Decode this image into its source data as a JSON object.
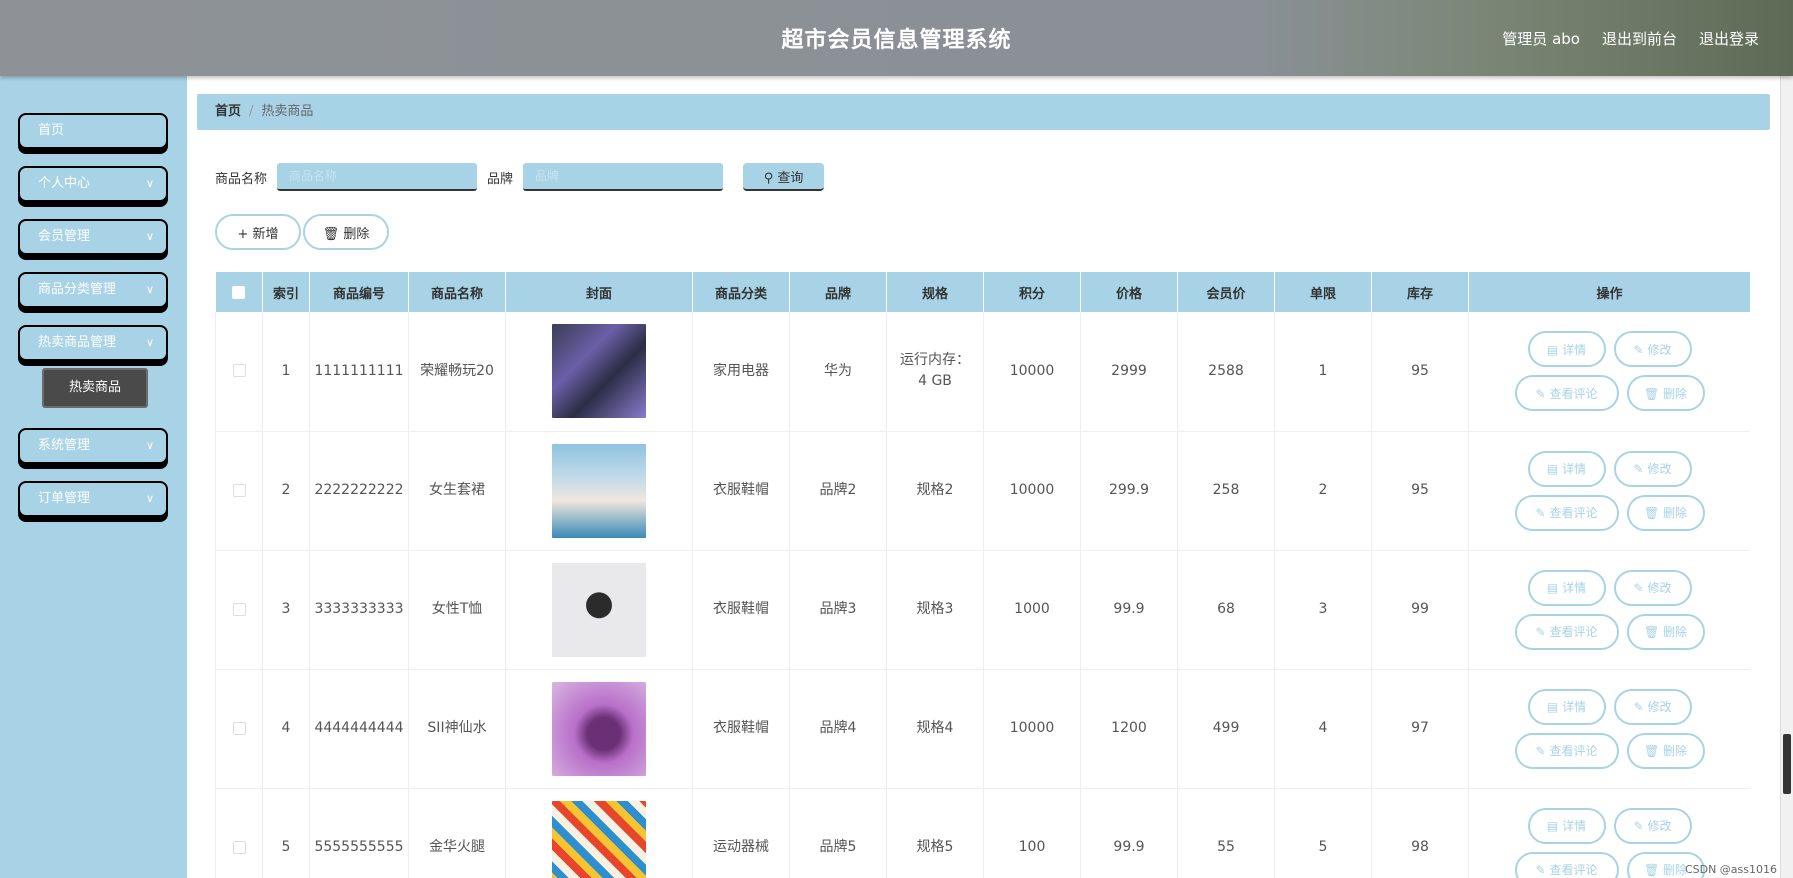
{
  "header": {
    "title": "超市会员信息管理系统",
    "admin": "管理员 abo",
    "to_front": "退出到前台",
    "logout": "退出登录"
  },
  "sidebar": {
    "items": [
      {
        "label": "首页",
        "has_children": false
      },
      {
        "label": "个人中心",
        "has_children": true
      },
      {
        "label": "会员管理",
        "has_children": true
      },
      {
        "label": "商品分类管理",
        "has_children": true
      },
      {
        "label": "热卖商品管理",
        "has_children": true
      },
      {
        "label": "系统管理",
        "has_children": true
      },
      {
        "label": "订单管理",
        "has_children": true
      }
    ],
    "active_sub": "热卖商品"
  },
  "breadcrumb": {
    "home": "首页",
    "separator": "/",
    "current": "热卖商品"
  },
  "search": {
    "name_label": "商品名称",
    "name_placeholder": "商品名称",
    "brand_label": "品牌",
    "brand_placeholder": "品牌",
    "query_label": "查询"
  },
  "actions": {
    "add_label": "新增",
    "delete_label": "删除"
  },
  "table": {
    "headers": [
      "索引",
      "商品编号",
      "商品名称",
      "封面",
      "商品分类",
      "品牌",
      "规格",
      "积分",
      "价格",
      "会员价",
      "单限",
      "库存",
      "操作"
    ],
    "rows": [
      {
        "index": "1",
        "code": "1111111111",
        "name": "荣耀畅玩20",
        "category": "家用电器",
        "brand": "华为",
        "spec": "运行内存：4 GB",
        "points": "10000",
        "price": "2999",
        "member_price": "2588",
        "limit": "1",
        "stock": "95"
      },
      {
        "index": "2",
        "code": "2222222222",
        "name": "女生套裙",
        "category": "衣服鞋帽",
        "brand": "品牌2",
        "spec": "规格2",
        "points": "10000",
        "price": "299.9",
        "member_price": "258",
        "limit": "2",
        "stock": "95"
      },
      {
        "index": "3",
        "code": "3333333333",
        "name": "女性T恤",
        "category": "衣服鞋帽",
        "brand": "品牌3",
        "spec": "规格3",
        "points": "1000",
        "price": "99.9",
        "member_price": "68",
        "limit": "3",
        "stock": "99"
      },
      {
        "index": "4",
        "code": "4444444444",
        "name": "SII神仙水",
        "category": "衣服鞋帽",
        "brand": "品牌4",
        "spec": "规格4",
        "points": "10000",
        "price": "1200",
        "member_price": "499",
        "limit": "4",
        "stock": "97"
      },
      {
        "index": "5",
        "code": "5555555555",
        "name": "金华火腿",
        "category": "运动器械",
        "brand": "品牌5",
        "spec": "规格5",
        "points": "100",
        "price": "99.9",
        "member_price": "55",
        "limit": "5",
        "stock": "98"
      }
    ],
    "op_labels": {
      "detail": "详情",
      "edit": "修改",
      "comments": "查看评论",
      "delete": "删除"
    }
  },
  "watermark": "CSDN @ass1016",
  "colors": {
    "accent": "#a8d3e6",
    "header": "#8e9297",
    "submenu_active": "#4a4a4a"
  }
}
